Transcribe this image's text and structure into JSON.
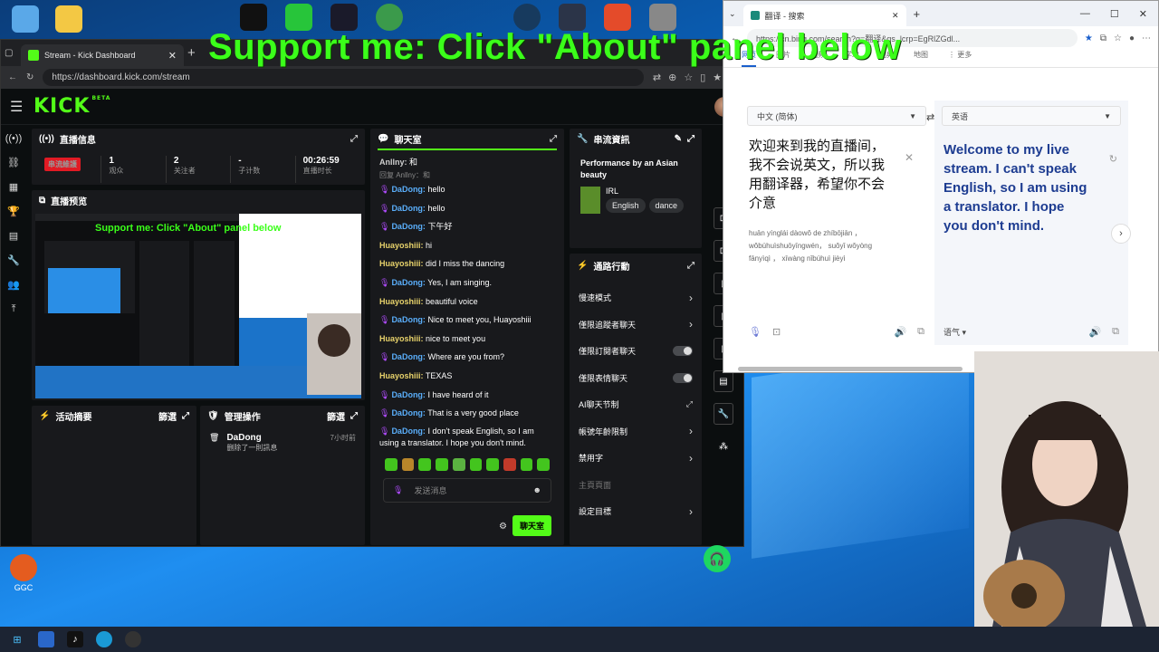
{
  "overlay": {
    "banner": "Support me: Click \"About\" panel below"
  },
  "kick_window": {
    "tab_title": "Stream - Kick Dashboard",
    "url": "https://dashboard.kick.com/stream",
    "logo": "KICK",
    "beta": "BETA",
    "panels": {
      "stream_info": {
        "title": "直播信息",
        "live_badge": "串流維護",
        "stats": [
          {
            "value": "1",
            "label": "观众"
          },
          {
            "value": "2",
            "label": "关注者"
          },
          {
            "value": "-",
            "label": "子计数"
          },
          {
            "value": "00:26:59",
            "label": "直播时长"
          }
        ]
      },
      "preview": {
        "title": "直播预览",
        "inner_banner": "Support me: Click \"About\" panel below"
      },
      "activity": {
        "title": "活动摘要",
        "filter": "篩選"
      },
      "mod_actions": {
        "title": "管理操作",
        "filter": "篩選",
        "entry": {
          "user": "DaDong",
          "action": "删除了一則訊息",
          "time": "7小时前"
        }
      },
      "chat": {
        "title": "聊天室",
        "top_msg": {
          "user": "Anllny:",
          "text": "和"
        },
        "reply": "回复 Anllny：和",
        "messages": [
          {
            "user": "DaDong:",
            "text": "hello",
            "mic": true
          },
          {
            "user": "DaDong:",
            "text": "hello",
            "mic": true
          },
          {
            "user": "DaDong:",
            "text": "下午好",
            "mic": true
          },
          {
            "user": "Huayoshiii:",
            "text": "hi",
            "mic": false
          },
          {
            "user": "Huayoshiii:",
            "text": "did I miss the dancing",
            "mic": false
          },
          {
            "user": "DaDong:",
            "text": "Yes, I am singing.",
            "mic": true
          },
          {
            "user": "Huayoshiii:",
            "text": "beautiful voice",
            "mic": false
          },
          {
            "user": "DaDong:",
            "text": "Nice to meet you, Huayoshiii",
            "mic": true
          },
          {
            "user": "Huayoshiii:",
            "text": "nice to meet you",
            "mic": false
          },
          {
            "user": "DaDong:",
            "text": "Where are you from?",
            "mic": true
          },
          {
            "user": "Huayoshiii:",
            "text": "TEXAS",
            "mic": false
          },
          {
            "user": "DaDong:",
            "text": "I have heard of it",
            "mic": true
          },
          {
            "user": "DaDong:",
            "text": "That is a very good place",
            "mic": true
          },
          {
            "user": "DaDong:",
            "text": "I don't speak English, so I am using a translator. I hope you don't mind.",
            "mic": true
          }
        ],
        "input_placeholder": "发送消息",
        "send_label": "聊天室"
      },
      "stream_details": {
        "title": "串流資訊",
        "stream_title": "Performance by an Asian beauty",
        "category": "IRL",
        "tags": [
          "English",
          "dance"
        ]
      },
      "quick_actions": {
        "title": "通路行動",
        "rows": [
          {
            "label": "慢速模式",
            "control": "chevron"
          },
          {
            "label": "僅限追蹤者聊天",
            "control": "chevron"
          },
          {
            "label": "僅限訂閱者聊天",
            "control": "toggle"
          },
          {
            "label": "僅限表情聊天",
            "control": "toggle"
          },
          {
            "label": "AI聊天节制",
            "control": "external"
          },
          {
            "label": "帳號年齡限制",
            "control": "chevron"
          },
          {
            "label": "禁用字",
            "control": "chevron"
          },
          {
            "label": "主頁頁面",
            "control": "section"
          },
          {
            "label": "設定目標",
            "control": "chevron"
          }
        ]
      }
    }
  },
  "edge_window": {
    "tab_title": "翻译 - 搜索",
    "url": "https://cn.bing.com/search?q=翻译&qs_lcrp=EgRlZGdl...",
    "nav_tabs": [
      "网页",
      "图片",
      "视频",
      "学术",
      "词典",
      "地图",
      "⋮ 更多"
    ],
    "source_lang": "中文 (简体)",
    "target_lang": "英语",
    "source_text": "欢迎来到我的直播间，我不会说英文，所以我用翻译器，希望你不会介意",
    "pinyin": "huān yínglái dàowǒ de zhíbōjiān ，wǒbúhuìshuōyīngwén， suǒyǐ wǒyòng fānyìqì ， xīwàng nǐbúhuì jièyì",
    "target_text": "Welcome to my live stream. I can't speak English, so I am using a translator. I hope you don't mind.",
    "tone_label": "语气"
  },
  "desktop": {
    "icon_label_ggc": "GGC"
  }
}
